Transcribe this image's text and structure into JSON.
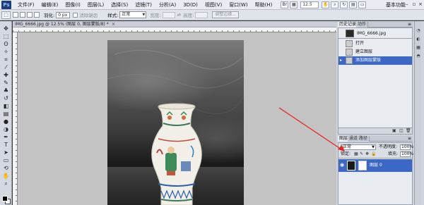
{
  "app": {
    "logo_text": "Ps",
    "workspace_label": "基本功能"
  },
  "menu": {
    "items": [
      "文件(F)",
      "编辑(E)",
      "图像(I)",
      "图层(L)",
      "选择(S)",
      "滤镜(T)",
      "分析(A)",
      "3D(D)",
      "视图(V)",
      "窗口(W)",
      "帮助(H)"
    ]
  },
  "appbar": {
    "zoom_value": "12.5"
  },
  "options": {
    "feather_label": "羽化:",
    "feather_value": "0 px",
    "antialias_label": "消除锯齿",
    "style_label": "样式:",
    "style_value": "正常",
    "width_label": "宽度:",
    "height_label": "高度:",
    "refine_edge_label": "调整边缘..."
  },
  "document": {
    "title": "IMG_6666.jpg @ 12.5% (图层 0, 图层蒙版/8) *",
    "close_glyph": "×"
  },
  "panels": {
    "history": {
      "tabs": [
        "历史记录",
        "动作"
      ],
      "snapshot": "IMG_6666.jpg",
      "steps": [
        "打开",
        "建立图层",
        "添加图层蒙版"
      ],
      "selected_index": 2
    },
    "layers": {
      "tabs": [
        "图层",
        "通道",
        "路径"
      ],
      "blend_mode": "正常",
      "opacity_label": "不透明度:",
      "opacity_value": "100%",
      "lock_label": "锁定:",
      "fill_label": "填充:",
      "fill_value": "100%",
      "layer_name": "图层 0"
    }
  },
  "annotation": {
    "color": "#e8231f"
  },
  "colors": {
    "foreground": "#000000",
    "background": "#ffffff",
    "selection": "#3c67c4"
  }
}
